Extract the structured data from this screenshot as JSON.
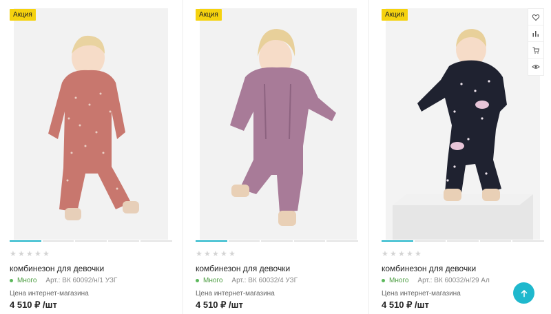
{
  "products": [
    {
      "badge": "Акция",
      "title": "комбинезон для девочки",
      "stock": "Много",
      "article": "Арт.: ВК 60092/н/1 УЗГ",
      "price_label": "Цена интернет-магазина",
      "price": "4 510 ₽ /шт",
      "rating": 0,
      "suit_color": "#c8776e"
    },
    {
      "badge": "Акция",
      "title": "комбинезон для девочки",
      "stock": "Много",
      "article": "Арт.: ВК 60032/4 УЗГ",
      "price_label": "Цена интернет-магазина",
      "price": "4 510 ₽ /шт",
      "rating": 0,
      "suit_color": "#a87b98"
    },
    {
      "badge": "Акция",
      "title": "комбинезон для девочки",
      "stock": "Много",
      "article": "Арт.: ВК 60032/н/29 Ал",
      "price_label": "Цена интернет-магазина",
      "price": "4 510 ₽ /шт",
      "rating": 0,
      "suit_color": "#1f2230"
    }
  ],
  "actions": [
    "heart-icon",
    "compare-icon",
    "cart-icon",
    "eye-icon"
  ],
  "colors": {
    "accent": "#1fb8cd",
    "badge": "#f5d20f",
    "stock": "#4a9b3f"
  }
}
